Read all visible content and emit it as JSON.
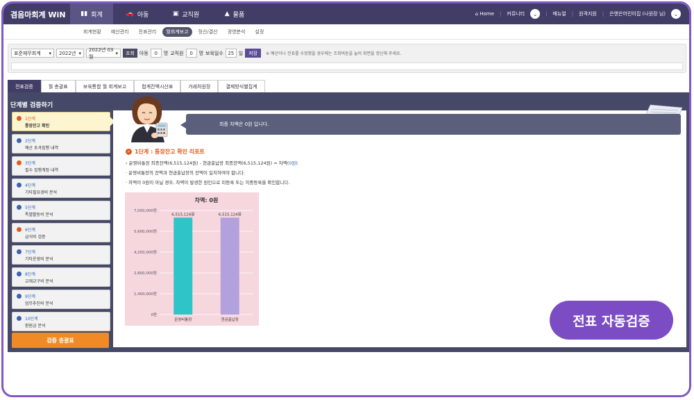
{
  "app": {
    "brand": "겸음마회계 WiN"
  },
  "main_nav": [
    {
      "label": "회계",
      "icon": "bar-chart-icon"
    },
    {
      "label": "아동",
      "icon": "car-icon"
    },
    {
      "label": "교직원",
      "icon": "id-card-icon"
    },
    {
      "label": "물품",
      "icon": "boxes-icon"
    }
  ],
  "top_right": {
    "home": "Home",
    "community": "커뮤니티",
    "manual": "매뉴얼",
    "remote": "원격지원",
    "user": "은앤은어린이집 (나원장 님)"
  },
  "sub_nav": [
    "회계현황",
    "예산관리",
    "전표관리",
    "월회계보고",
    "정산/결산",
    "경영분석",
    "설정"
  ],
  "filters": {
    "account_type": "표준재무회계",
    "year": "2022년",
    "month": "2022년 03월",
    "search": "조회",
    "child_label": "아동",
    "child_value": "0",
    "child_unit": "명",
    "staff_label": "교직원",
    "staff_value": "0",
    "staff_unit": "명",
    "days_label": "보육일수",
    "days_value": "25",
    "days_unit": "일",
    "save": "저장",
    "notice": "※ 예산이나 전표를 수정했을 경우에는 조회버튼을 눌러 화면을 갱신해 주세요."
  },
  "tabs": [
    "전표검증",
    "월 총괄표",
    "보육통합 월 회계보고",
    "합계잔액시산표",
    "거래처원장",
    "결제방식별집계"
  ],
  "panel_title": "단계별 검증하기",
  "steps": [
    {
      "title": "1단계",
      "desc": "통장잔고 확인",
      "dot": "orange"
    },
    {
      "title": "2단계",
      "desc": "예산 초과집행 내역",
      "dot": "blue"
    },
    {
      "title": "3단계",
      "desc": "필수 집행계정 내역",
      "dot": "orange"
    },
    {
      "title": "4단계",
      "desc": "기타필요경비 분석",
      "dot": "blue"
    },
    {
      "title": "5단계",
      "desc": "특별활동비 분석",
      "dot": "blue"
    },
    {
      "title": "6단계",
      "desc": "급식비 검증",
      "dot": "orange"
    },
    {
      "title": "7단계",
      "desc": "기타운영비 분석",
      "dot": "blue"
    },
    {
      "title": "8단계",
      "desc": "교재교구비 분석",
      "dot": "blue"
    },
    {
      "title": "9단계",
      "desc": "업무추진비 분석",
      "dot": "blue"
    },
    {
      "title": "10단계",
      "desc": "환원금 분석",
      "dot": "blue"
    }
  ],
  "summary_button": "검증 총괄표",
  "bubble_text": "최종 차액은 0원 입니다.",
  "report": {
    "title": "1단계 : 통장잔고 확인 리포트",
    "line1_a": "› 운영비통장 최종잔액(6,515,124원) - 현금출납장 최종잔액(6,515,124원) = 차액(",
    "line1_b": "0원",
    "line1_c": ")",
    "line2": "· 운영비통장의 잔액과 현금출납장의 잔액이 일치하여야 합니다.",
    "line3": "· 차액이 0원이 아닐 경우, 차액이 발생한 원인으로 미등록 또는 이중등록을 확인합니다."
  },
  "chart_data": {
    "type": "bar",
    "title": "차액: 0원",
    "categories": [
      "운영비통장",
      "현금출납장"
    ],
    "values": [
      6515124,
      6515124
    ],
    "value_labels": [
      "6,515,124원",
      "6,515,124원"
    ],
    "colors": [
      "#2ec4c8",
      "#b3a1dd"
    ],
    "ylim": [
      0,
      7000000
    ],
    "yticks": [
      0,
      1400000,
      2800000,
      4200000,
      5600000,
      7000000
    ],
    "ytick_labels": [
      "0원",
      "1,400,000원",
      "2,800,000원",
      "4,200,000원",
      "5,600,000원",
      "7,000,000원"
    ],
    "grid": true
  },
  "badge": "전표 자동검증"
}
